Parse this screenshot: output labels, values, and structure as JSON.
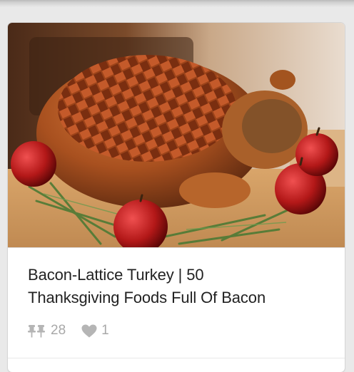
{
  "pin": {
    "title_line1": "Bacon-Lattice Turkey | 50",
    "title_line2": "Thanksgiving Foods Full Of Bacon",
    "repins_count": "28",
    "likes_count": "1",
    "image_alt": "Bacon-lattice wrapped roast turkey with red apples and rosemary on a wooden board"
  },
  "icons": {
    "repin": "pushpin-icon",
    "like": "heart-icon"
  },
  "colors": {
    "background": "#e9e9e9",
    "card": "#ffffff",
    "title_text": "#222222",
    "stat_text": "#a8a8a8"
  }
}
